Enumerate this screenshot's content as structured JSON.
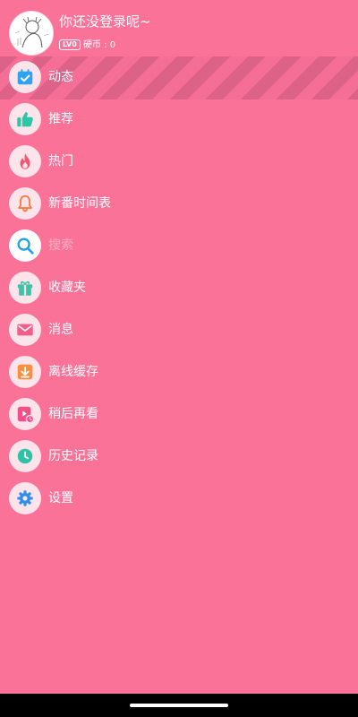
{
  "user": {
    "name": "你还没登录呢~",
    "level_badge": "LV0",
    "coins": "硬币 : 0"
  },
  "menu": {
    "items": [
      {
        "label": "动态",
        "icon": "calendar-check-icon",
        "color": "#2fa3f2"
      },
      {
        "label": "推荐",
        "icon": "thumbs-up-icon",
        "color": "#2cc5a5"
      },
      {
        "label": "热门",
        "icon": "flame-icon",
        "color": "#f2576f"
      },
      {
        "label": "新番时间表",
        "icon": "bell-icon",
        "color": "#fb7a3d"
      },
      {
        "label": "搜索",
        "icon": "search-icon",
        "color": "#21a3e6"
      },
      {
        "label": "收藏夹",
        "icon": "gift-icon",
        "color": "#3ec3a7"
      },
      {
        "label": "消息",
        "icon": "mail-icon",
        "color": "#f25e8a"
      },
      {
        "label": "离线缓存",
        "icon": "download-icon",
        "color": "#fb8f3d"
      },
      {
        "label": "稍后再看",
        "icon": "watch-later-icon",
        "color": "#f0518a"
      },
      {
        "label": "历史记录",
        "icon": "clock-icon",
        "color": "#2fc2a6"
      },
      {
        "label": "设置",
        "icon": "gear-icon",
        "color": "#2f8eea"
      }
    ]
  },
  "colors": {
    "background": "#fb7299",
    "icon_bubble": "#fde3ea",
    "system_nav_bar": "#000000"
  }
}
